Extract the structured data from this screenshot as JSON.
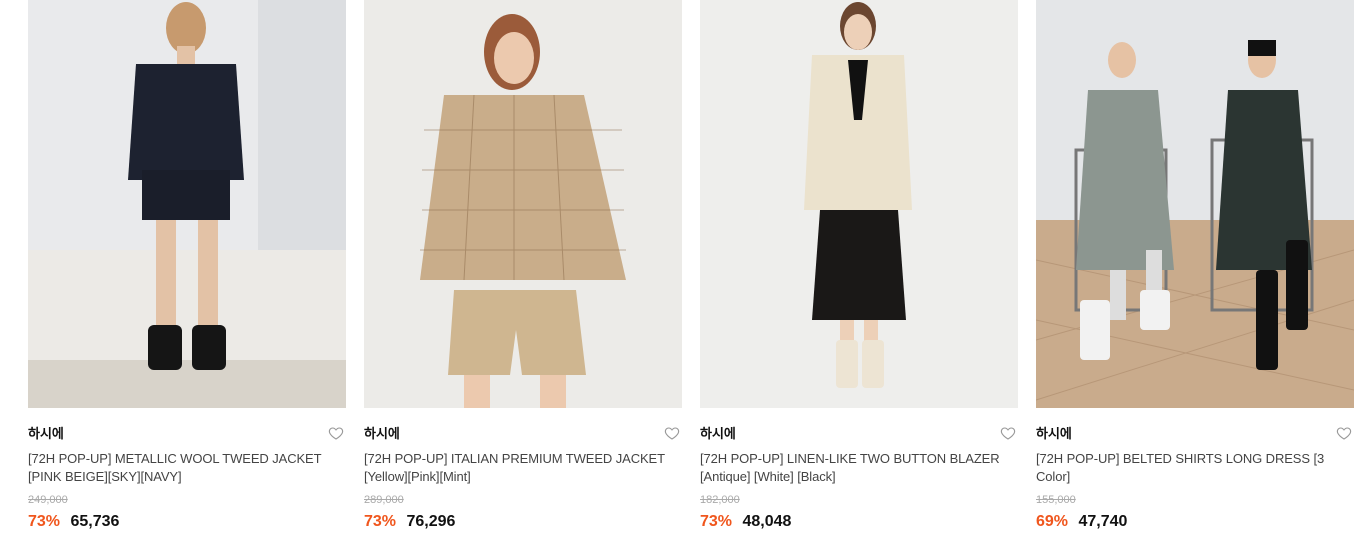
{
  "products": [
    {
      "brand": "하시에",
      "title": "[72H POP-UP] METALLIC WOOL TWEED JACKET [PINK BEIGE][SKY][NAVY]",
      "original_price": "249,000",
      "discount": "73%",
      "price": "65,736",
      "icon": "heart-outline-icon"
    },
    {
      "brand": "하시에",
      "title": "[72H POP-UP] ITALIAN PREMIUM TWEED JACKET [Yellow][Pink][Mint]",
      "original_price": "289,000",
      "discount": "73%",
      "price": "76,296",
      "icon": "heart-outline-icon"
    },
    {
      "brand": "하시에",
      "title": "[72H POP-UP] LINEN-LIKE TWO BUTTON BLAZER [Antique] [White] [Black]",
      "original_price": "182,000",
      "discount": "73%",
      "price": "48,048",
      "icon": "heart-outline-icon"
    },
    {
      "brand": "하시에",
      "title": "[72H POP-UP] BELTED SHIRTS LONG DRESS [3 Color]",
      "original_price": "155,000",
      "discount": "69%",
      "price": "47,740",
      "icon": "heart-outline-icon"
    }
  ],
  "colors": {
    "discount": "#f0561d",
    "price": "#111111",
    "original_price": "#aaaaaa"
  }
}
